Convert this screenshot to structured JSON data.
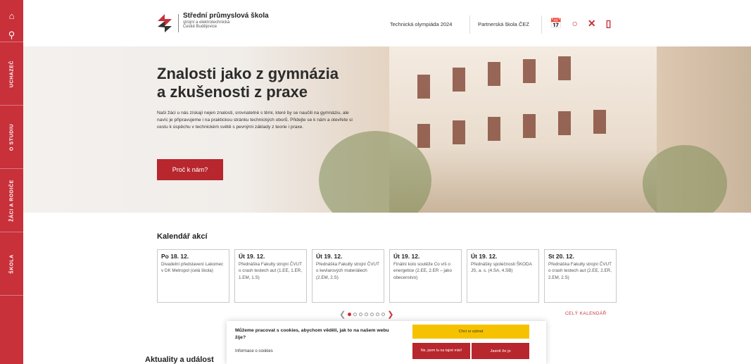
{
  "sidebar": {
    "top_icons": [
      "home-icon",
      "search-icon"
    ],
    "items": [
      {
        "label": "UCHAZEČ"
      },
      {
        "label": "O STUDIU"
      },
      {
        "label": "ŽÁCI A RODIČE"
      },
      {
        "label": "ŠKOLA"
      }
    ]
  },
  "header": {
    "logo_title": "Střední průmyslová škola",
    "logo_sub1": "strojní a elektrotechnická",
    "logo_sub2": "České Budějovice",
    "nav": [
      "Technická olympiáda 2024",
      "Partnerská škola ČEZ"
    ],
    "icons": [
      "calendar-icon",
      "circle-icon",
      "x-icon",
      "office-icon"
    ],
    "accent": "#c8303a"
  },
  "hero": {
    "title_line1": "Znalosti jako z gymnázia",
    "title_line2": "a zkušenosti z praxe",
    "text": "Naši žáci u nás získají nejen znalosti, srovnatelné s těmi, které by se naučili na gymnáziu, ale navíc je připravujeme i na praktickou stránku technických oborů. Přidejte se k nám a otevřete si cestu k úspěchu v technickém světě s pevnými základy z teorie i praxe.",
    "button": "Proč k nám?"
  },
  "calendar": {
    "title": "Kalendář akcí",
    "cards": [
      {
        "date": "Po 18. 12.",
        "text": "Divadelní představení Lakomec v DK Metropol (celá škola)"
      },
      {
        "date": "Út 19. 12.",
        "text": "Přednáška Fakulty strojní ČVUT o crash testech aut (1.EE, 1.ER, 1.EM, 1.S)"
      },
      {
        "date": "Út 19. 12.",
        "text": "Přednáška Fakulty strojní ČVUT o kevlarových materiálech (2.EM, 2.S)"
      },
      {
        "date": "Út 19. 12.",
        "text": "Finální kolo soutěže Co víš o energetice (2.EE, 2.ER – jako obecenstvo)"
      },
      {
        "date": "Út 19. 12.",
        "text": "Přednášky společnosti ŠKODA JS, a. s. (4.SA, 4.SB)"
      },
      {
        "date": "St 20. 12.",
        "text": "Přednáška Fakulty strojní ČVUT o crash testech aut (2.EE, 2.ER, 2.EM, 2.S)"
      }
    ],
    "page_current": 1,
    "page_count": 7,
    "full_link": "CELÝ KALENDÁŘ"
  },
  "news": {
    "title": "Aktuality a událost"
  },
  "cookie": {
    "message": "Můžeme pracovat s cookies, abychom věděli, jak to na našem webu žije?",
    "info_link": "Informace o cookies",
    "choose_button": "Chci si vybrat",
    "reject_button": "Ne, jsem tu na tajné misi!",
    "accept_button": "Jasně že jo"
  }
}
